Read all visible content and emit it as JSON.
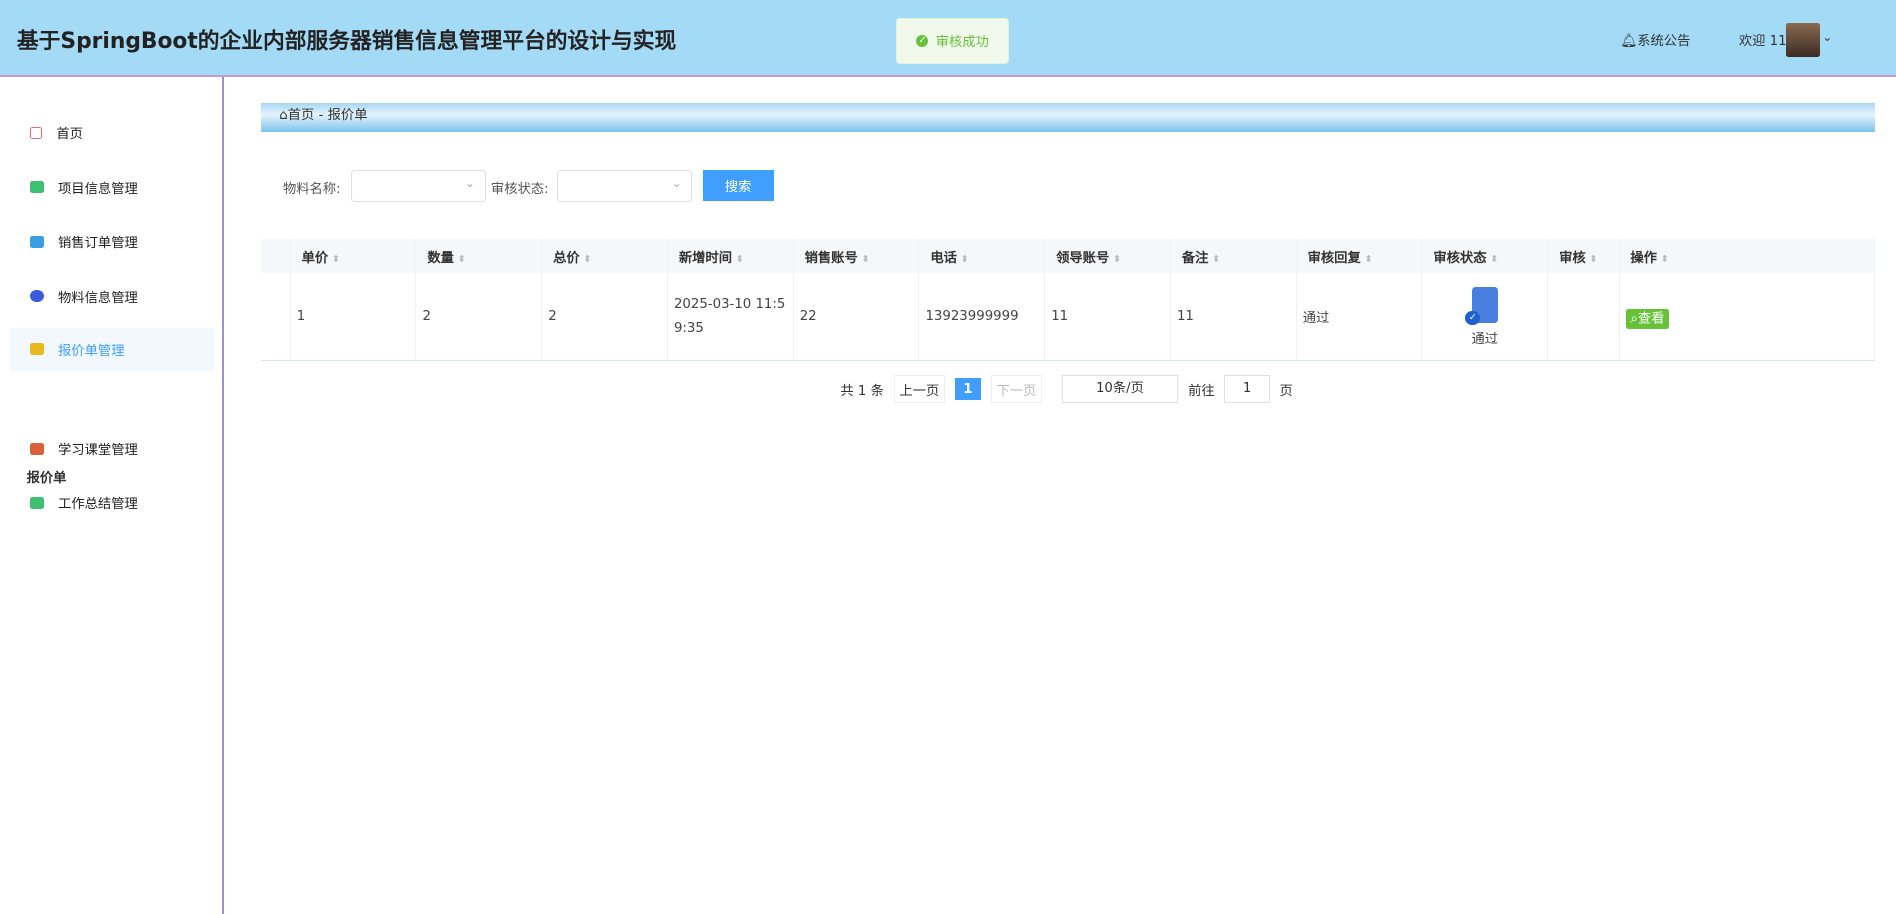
{
  "header": {
    "title": "基于SpringBoot的企业内部服务器销售信息管理平台的设计与实现",
    "toast": "审核成功",
    "notice": "系统公告",
    "welcome": "欢迎 11"
  },
  "sidebar": {
    "items": [
      {
        "label": "首页",
        "color": "#e06c6c"
      },
      {
        "label": "项目信息管理",
        "color": "#3fbf6f"
      },
      {
        "label": "销售订单管理",
        "color": "#3a9ee0"
      },
      {
        "label": "物料信息管理",
        "color": "#3b5bd9"
      },
      {
        "label": "报价单管理",
        "color": "#e8b820"
      },
      {
        "label": "学习课堂管理",
        "color": "#d9603b"
      },
      {
        "label": "工作总结管理",
        "color": "#3fbf6f"
      }
    ],
    "sublabel": "报价单"
  },
  "breadcrumb": {
    "home": "首页",
    "sep": "-",
    "current": "报价单"
  },
  "search": {
    "material_label": "物料名称:",
    "status_label": "审核状态:",
    "button": "搜索"
  },
  "table": {
    "headers": [
      "单价",
      "数量",
      "总价",
      "新增时间",
      "销售账号",
      "电话",
      "领导账号",
      "备注",
      "审核回复",
      "审核状态",
      "审核",
      "操作"
    ],
    "rows": [
      {
        "price": "1",
        "qty": "2",
        "total": "2",
        "time": "2025-03-10 11:59:35",
        "sales": "22",
        "phone": "13923999999",
        "leader": "11",
        "remark": "11",
        "reply": "通过",
        "status": "通过",
        "action": "查看"
      }
    ]
  },
  "pagination": {
    "total": "共 1 条",
    "prev": "上一页",
    "page": "1",
    "next": "下一页",
    "size": "10条/页",
    "goto": "前往",
    "goto_value": "1",
    "page_unit": "页"
  }
}
